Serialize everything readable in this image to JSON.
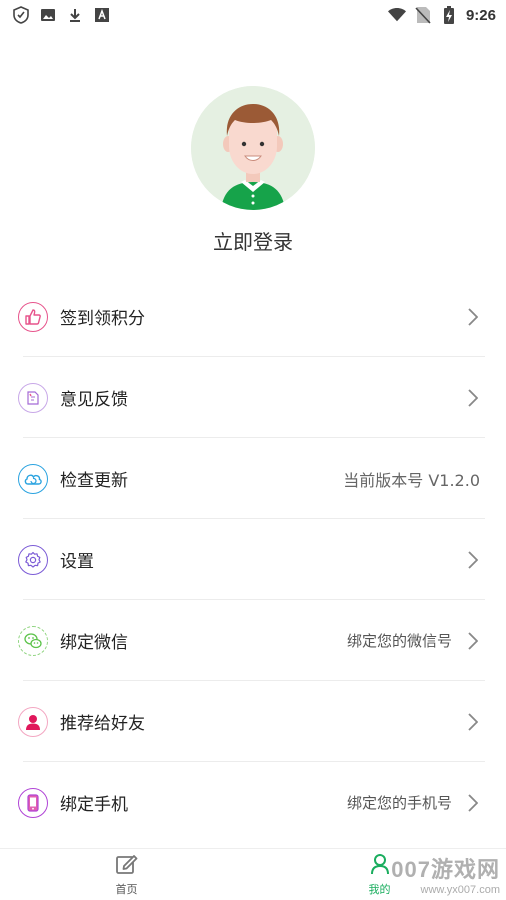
{
  "status_bar": {
    "time": "9:26",
    "left_icons": [
      "shield-icon",
      "image-icon",
      "download-icon",
      "font-icon"
    ],
    "right_icons": [
      "wifi-icon",
      "no-sim-icon",
      "battery-icon"
    ]
  },
  "profile": {
    "login_label": "立即登录"
  },
  "menu": [
    {
      "label": "签到领积分",
      "value": "",
      "icon": "thumbs-up-icon",
      "color": "#e7548c"
    },
    {
      "label": "意见反馈",
      "value": "",
      "icon": "feedback-icon",
      "color": "#a56bd6"
    },
    {
      "label": "检查更新",
      "value": "当前版本号 V1.2.0",
      "icon": "cloud-refresh-icon",
      "color": "#2aa3e0"
    },
    {
      "label": "设置",
      "value": "",
      "icon": "gear-icon",
      "color": "#7b5bd6"
    },
    {
      "label": "绑定微信",
      "value": "绑定您的微信号",
      "icon": "wechat-icon",
      "color": "#5cc34a"
    },
    {
      "label": "推荐给好友",
      "value": "",
      "icon": "person-icon",
      "color": "#e0175b"
    },
    {
      "label": "绑定手机",
      "value": "绑定您的手机号",
      "icon": "phone-icon",
      "color": "#b044d6"
    }
  ],
  "tabs": [
    {
      "label": "首页",
      "icon": "edit-icon",
      "active": false
    },
    {
      "label": "我的",
      "icon": "user-icon",
      "active": true
    }
  ],
  "colors": {
    "accent_green": "#1aad5e",
    "avatar_bg": "#e5f0e2"
  },
  "watermark": {
    "title": "007游戏网",
    "url": "www.yx007.com"
  }
}
